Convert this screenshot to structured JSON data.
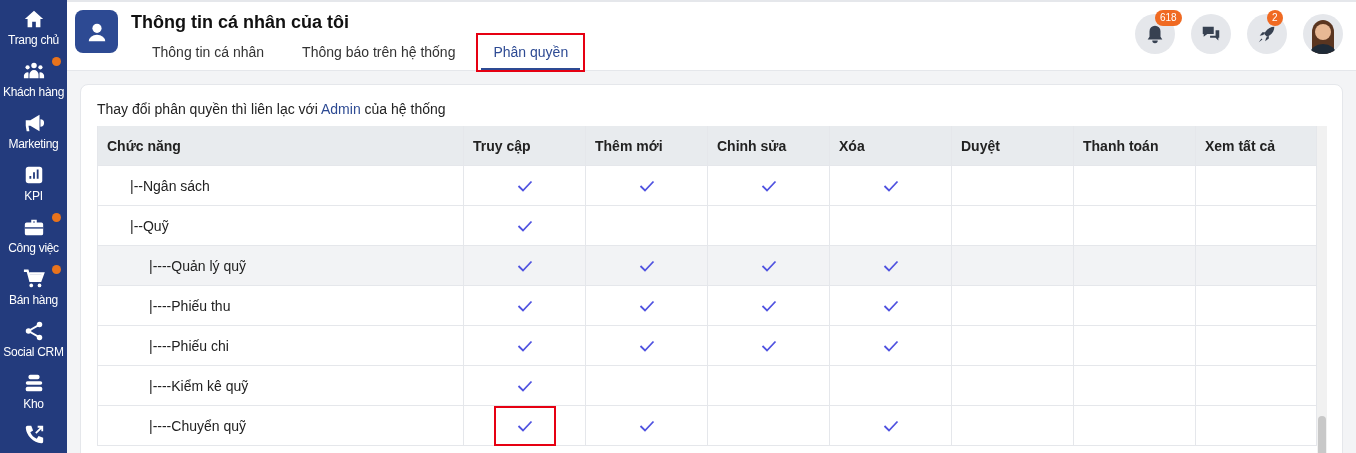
{
  "sidebar": {
    "items": [
      {
        "label": "Trang chủ",
        "kind": "home",
        "dot": false
      },
      {
        "label": "Khách hàng",
        "kind": "people",
        "dot": true
      },
      {
        "label": "Marketing",
        "kind": "megaphone",
        "dot": false
      },
      {
        "label": "KPI",
        "kind": "chart",
        "dot": false
      },
      {
        "label": "Công việc",
        "kind": "briefcase",
        "dot": true
      },
      {
        "label": "Bán hàng",
        "kind": "cart",
        "dot": true
      },
      {
        "label": "Social CRM",
        "kind": "share",
        "dot": false
      },
      {
        "label": "Kho",
        "kind": "stack",
        "dot": false
      },
      {
        "kind": "phone",
        "dot": false
      }
    ]
  },
  "header": {
    "title": "Thông tin cá nhân của tôi",
    "tabs": [
      {
        "label": "Thông tin cá nhân",
        "selected": false,
        "highlighted": false
      },
      {
        "label": "Thông báo trên hệ thống",
        "selected": false,
        "highlighted": false
      },
      {
        "label": "Phân quyền",
        "selected": true,
        "highlighted": true
      }
    ],
    "actions": [
      {
        "kind": "bell",
        "badge": "618"
      },
      {
        "kind": "chat"
      },
      {
        "kind": "rocket",
        "badge": "2"
      }
    ]
  },
  "notice": {
    "text_before": "Thay đổi phân quyền thì liên lạc với",
    "link": "Admin",
    "text_after": "của hệ thống"
  },
  "table": {
    "columns": [
      "Chức năng",
      "Truy cập",
      "Thêm mới",
      "Chỉnh sửa",
      "Xóa",
      "Duyệt",
      "Thanh toán",
      "Xem tất cả"
    ],
    "rows": [
      {
        "name": "|--Ngân sách",
        "hovered": false,
        "cells": [
          {
            "checked": true,
            "highlighted": false
          },
          {
            "checked": true,
            "highlighted": false
          },
          {
            "checked": true,
            "highlighted": false
          },
          {
            "checked": true,
            "highlighted": false
          },
          {
            "checked": false,
            "highlighted": false
          },
          {
            "checked": false,
            "highlighted": false
          },
          {
            "checked": false,
            "highlighted": false
          }
        ]
      },
      {
        "name": "|--Quỹ",
        "hovered": false,
        "cells": [
          {
            "checked": true,
            "highlighted": false
          },
          {
            "checked": false,
            "highlighted": false
          },
          {
            "checked": false,
            "highlighted": false
          },
          {
            "checked": false,
            "highlighted": false
          },
          {
            "checked": false,
            "highlighted": false
          },
          {
            "checked": false,
            "highlighted": false
          },
          {
            "checked": false,
            "highlighted": false
          }
        ],
        "children": [
          {
            "name": "|----Quản lý quỹ",
            "hovered": true,
            "cells": [
              {
                "checked": true,
                "highlighted": false
              },
              {
                "checked": true,
                "highlighted": false
              },
              {
                "checked": true,
                "highlighted": false
              },
              {
                "checked": true,
                "highlighted": false
              },
              {
                "checked": false,
                "highlighted": false
              },
              {
                "checked": false,
                "highlighted": false
              },
              {
                "checked": false,
                "highlighted": false
              }
            ]
          },
          {
            "name": "|----Phiếu thu",
            "hovered": false,
            "cells": [
              {
                "checked": true,
                "highlighted": false
              },
              {
                "checked": true,
                "highlighted": false
              },
              {
                "checked": true,
                "highlighted": false
              },
              {
                "checked": true,
                "highlighted": false
              },
              {
                "checked": false,
                "highlighted": false
              },
              {
                "checked": false,
                "highlighted": false
              },
              {
                "checked": false,
                "highlighted": false
              }
            ]
          },
          {
            "name": "|----Phiếu chi",
            "hovered": false,
            "cells": [
              {
                "checked": true,
                "highlighted": false
              },
              {
                "checked": true,
                "highlighted": false
              },
              {
                "checked": true,
                "highlighted": false
              },
              {
                "checked": true,
                "highlighted": false
              },
              {
                "checked": false,
                "highlighted": false
              },
              {
                "checked": false,
                "highlighted": false
              },
              {
                "checked": false,
                "highlighted": false
              }
            ]
          },
          {
            "name": "|----Kiểm kê quỹ",
            "hovered": false,
            "cells": [
              {
                "checked": true,
                "highlighted": false
              },
              {
                "checked": false,
                "highlighted": false
              },
              {
                "checked": false,
                "highlighted": false
              },
              {
                "checked": false,
                "highlighted": false
              },
              {
                "checked": false,
                "highlighted": false
              },
              {
                "checked": false,
                "highlighted": false
              },
              {
                "checked": false,
                "highlighted": false
              }
            ]
          },
          {
            "name": "|----Chuyển quỹ",
            "hovered": false,
            "cells": [
              {
                "checked": true,
                "highlighted": true
              },
              {
                "checked": true,
                "highlighted": false
              },
              {
                "checked": false,
                "highlighted": false
              },
              {
                "checked": true,
                "highlighted": false
              },
              {
                "checked": false,
                "highlighted": false
              },
              {
                "checked": false,
                "highlighted": false
              },
              {
                "checked": false,
                "highlighted": false
              }
            ]
          }
        ]
      }
    ]
  }
}
